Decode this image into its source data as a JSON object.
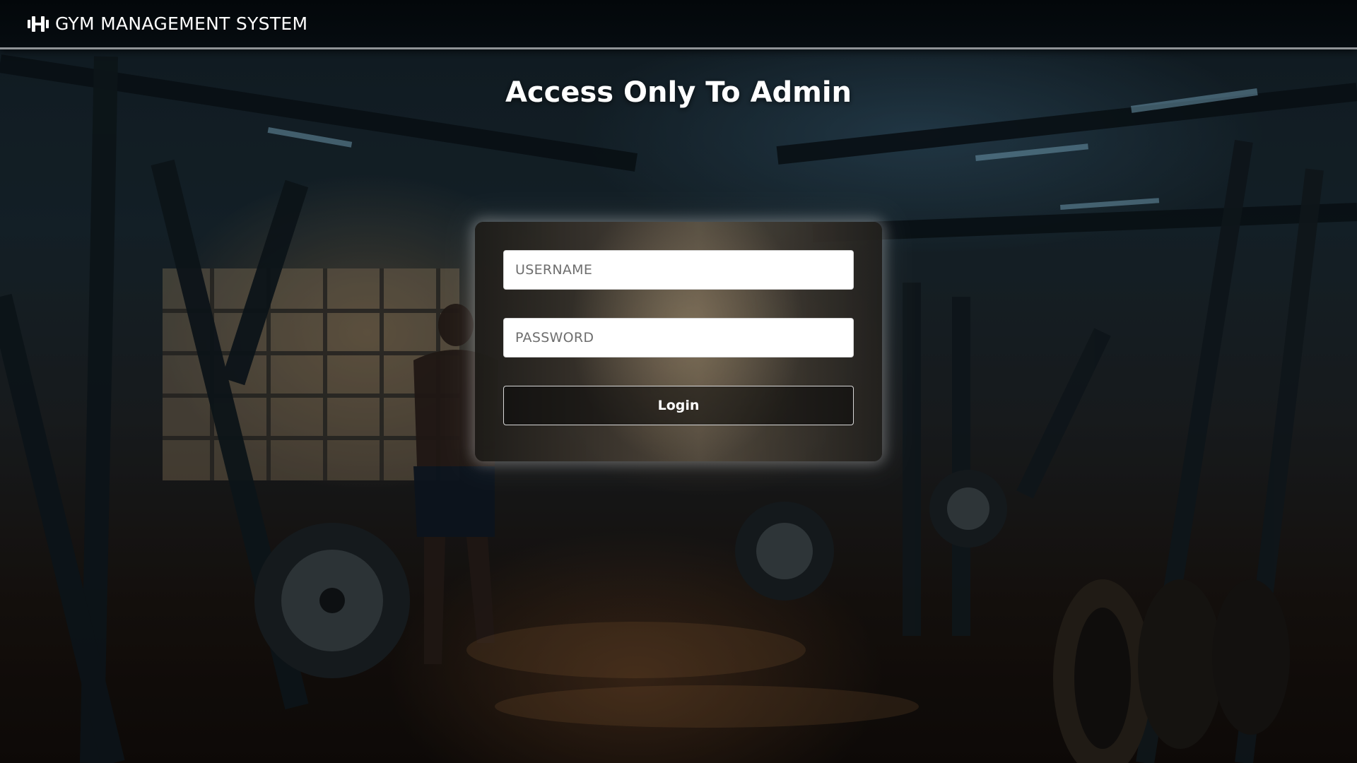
{
  "header": {
    "brand_icon": "dumbbell-icon",
    "title": "GYM MANAGEMENT SYSTEM"
  },
  "main": {
    "heading": "Access Only To Admin"
  },
  "login_form": {
    "username_placeholder": "USERNAME",
    "password_placeholder": "PASSWORD",
    "login_label": "Login"
  },
  "colors": {
    "topbar": "#05090c",
    "accent_border": "#8f9396",
    "text": "#ffffff"
  }
}
